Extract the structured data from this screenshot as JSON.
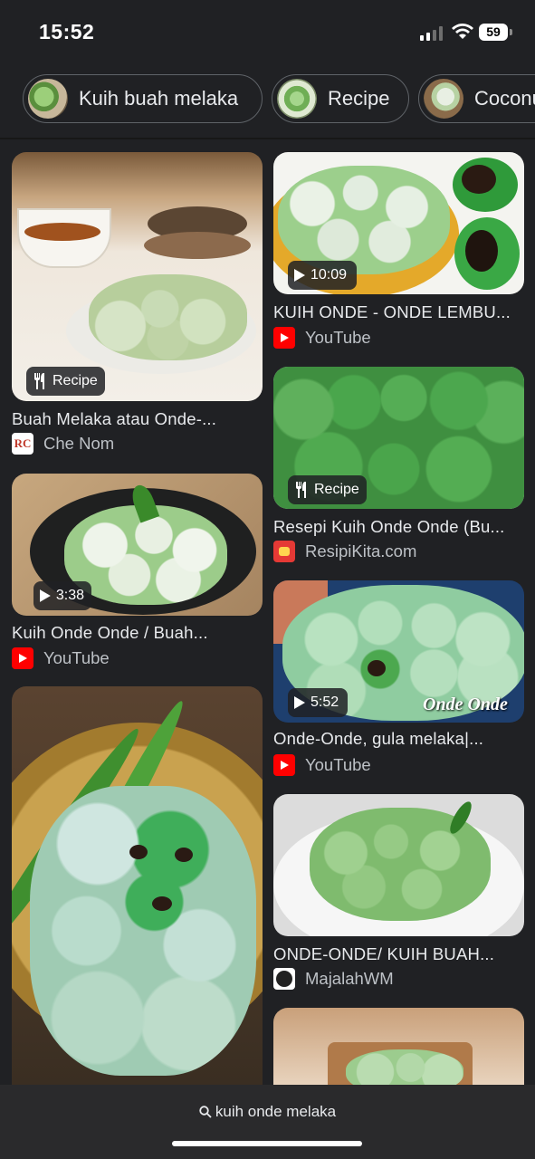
{
  "status_bar": {
    "time": "15:52",
    "battery": "59"
  },
  "chips": [
    {
      "label": "Kuih buah melaka"
    },
    {
      "label": "Recipe"
    },
    {
      "label": "Coconut"
    }
  ],
  "results": [
    {
      "title": "Buah Melaka atau Onde-...",
      "source": "Che Nom",
      "badge": "Recipe"
    },
    {
      "title": "KUIH ONDE - ONDE LEMBU...",
      "source": "YouTube",
      "badge": "10:09"
    },
    {
      "title": "Resepi Kuih Onde Onde (Bu...",
      "source": "ResipiKita.com",
      "badge": "Recipe"
    },
    {
      "title": "Kuih Onde Onde / Buah...",
      "source": "YouTube",
      "badge": "3:38"
    },
    {
      "title": "Onde-Onde, gula melaka|...",
      "source": "YouTube",
      "badge": "5:52",
      "overlay": "Onde Onde"
    },
    {
      "title": "ONDE-ONDE/ KUIH BUAH...",
      "source": "MajalahWM"
    }
  ],
  "search": {
    "query": "kuih onde melaka"
  },
  "colors": {
    "background": "#202124",
    "youtube": "#ff0000",
    "onde_green": "#4caf50"
  }
}
